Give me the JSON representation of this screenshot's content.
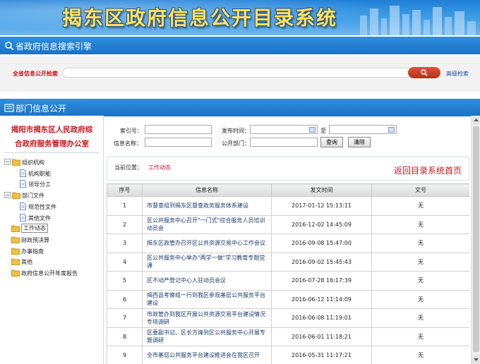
{
  "banner": {
    "title": "揭东区政府信息公开目录系统"
  },
  "search_section": {
    "title": "省政府信息搜索引擎",
    "label": "全省信息公开检索",
    "placeholder": "",
    "advanced": "高级检索"
  },
  "dept_section": {
    "title": "部门信息公开"
  },
  "dept": {
    "line1": "揭阳市揭东区人民政府综",
    "line2": "合政府服务管理办公室"
  },
  "tree": [
    {
      "label": "组织机构",
      "level": 0,
      "type": "folder",
      "toggle": "−"
    },
    {
      "label": "机构职能",
      "level": 1,
      "type": "doc"
    },
    {
      "label": "领导分工",
      "level": 1,
      "type": "doc"
    },
    {
      "label": "部门文件",
      "level": 0,
      "type": "folder",
      "toggle": "−"
    },
    {
      "label": "规范性文件",
      "level": 1,
      "type": "doc"
    },
    {
      "label": "其他文件",
      "level": 1,
      "type": "doc"
    },
    {
      "label": "工作动态",
      "level": 0,
      "type": "folder",
      "selected": true
    },
    {
      "label": "财政预决算",
      "level": 0,
      "type": "folder"
    },
    {
      "label": "办事指南",
      "level": 0,
      "type": "folder"
    },
    {
      "label": "其他",
      "level": 0,
      "type": "folder"
    },
    {
      "label": "政府信息公开年度报告",
      "level": 0,
      "type": "folder"
    }
  ],
  "filter": {
    "index_label": "索引号：",
    "name_label": "信息名称：",
    "date_label": "发布时间：",
    "date_sep": "至",
    "dept_label": "公开部门：",
    "query_btn": "查询",
    "clear_btn": "清除"
  },
  "location": {
    "label": "当前位置：",
    "value": "工作动态",
    "home_link": "返回目录系统首页"
  },
  "table": {
    "headers": [
      "序号",
      "信息名称",
      "发文时间",
      "文号"
    ],
    "rows": [
      {
        "no": "1",
        "name": "市督查组到揭东区督查政务服务体系建设",
        "time": "2017-01-12 15:13:11",
        "doc": "无"
      },
      {
        "no": "2",
        "name": "区公共服务中心召开\"一门式\"综合服务人员培训动员会",
        "time": "2016-12-02 14:45:09",
        "doc": "无"
      },
      {
        "no": "3",
        "name": "揭东区政管办召开区公共资源交易中心工作会议",
        "time": "2016-09-08 15:47:00",
        "doc": "无"
      },
      {
        "no": "4",
        "name": "区公共服务中心举办\"两学一做\"学习教育专题党课",
        "time": "2016-09-02 15:45:43",
        "doc": "无"
      },
      {
        "no": "5",
        "name": "区不动产登记中心入驻动员会议",
        "time": "2016-07-28 16:17:39",
        "doc": "无"
      },
      {
        "no": "6",
        "name": "揭西县考察组一行到我区参观基层公共服务平台建设",
        "time": "2016-06-12 11:14:09",
        "doc": "无"
      },
      {
        "no": "7",
        "name": "市政管办到我区开展公共资源交易平台建设情况专项调研",
        "time": "2016-06-08 11:19:01",
        "doc": "无"
      },
      {
        "no": "8",
        "name": "区委副书记、区长方烽到区公共服务中心开展专题调研",
        "time": "2016-06-01 11:18:21",
        "doc": "无"
      },
      {
        "no": "9",
        "name": "全市基层公共服务平台建设推进会在我区召开",
        "time": "2016-05-31 11:17:21",
        "doc": "无"
      }
    ]
  },
  "colors": {
    "accent_red": "#c8161d",
    "bar_blue": "#1d72c4",
    "banner_yellow": "#ffe35a"
  }
}
